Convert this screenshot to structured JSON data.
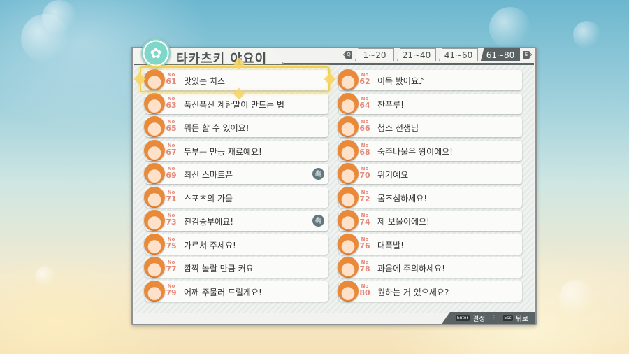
{
  "header": {
    "title": "타카츠키 야요이",
    "logo_icon": "idol-emblem-icon"
  },
  "tabs": [
    {
      "label": "1~20",
      "active": false
    },
    {
      "label": "21~40",
      "active": false
    },
    {
      "label": "41~60",
      "active": false
    },
    {
      "label": "61~80",
      "active": true
    }
  ],
  "tab_prev_key": "Q",
  "tab_next_key": "E",
  "no_prefix": "No",
  "items": [
    {
      "no": "61",
      "label": "맛있는 치즈",
      "clip": false
    },
    {
      "no": "62",
      "label": "이득 봤어요♪",
      "clip": false
    },
    {
      "no": "63",
      "label": "푹신푹신 계란말이 만드는 법",
      "clip": false
    },
    {
      "no": "64",
      "label": "찬푸루!",
      "clip": false
    },
    {
      "no": "65",
      "label": "뭐든 할 수 있어요!",
      "clip": false
    },
    {
      "no": "66",
      "label": "청소 선생님",
      "clip": false
    },
    {
      "no": "67",
      "label": "두부는 만능 재료예요!",
      "clip": false
    },
    {
      "no": "68",
      "label": "숙주나물은 왕이에요!",
      "clip": false
    },
    {
      "no": "69",
      "label": "최신 스마트폰",
      "clip": true
    },
    {
      "no": "70",
      "label": "위기예요",
      "clip": false
    },
    {
      "no": "71",
      "label": "스포츠의 가을",
      "clip": false
    },
    {
      "no": "72",
      "label": "몸조심하세요!",
      "clip": false
    },
    {
      "no": "73",
      "label": "진검승부예요!",
      "clip": true
    },
    {
      "no": "74",
      "label": "제 보물이에요!",
      "clip": false
    },
    {
      "no": "75",
      "label": "가르쳐 주세요!",
      "clip": false
    },
    {
      "no": "76",
      "label": "대폭발!",
      "clip": false
    },
    {
      "no": "77",
      "label": "깜짝 놀랄 만큼 커요",
      "clip": false
    },
    {
      "no": "78",
      "label": "과음에 주의하세요!",
      "clip": false
    },
    {
      "no": "79",
      "label": "어깨 주물러 드릴게요!",
      "clip": false
    },
    {
      "no": "80",
      "label": "원하는 거 있으세요?",
      "clip": false
    }
  ],
  "selected_no": "61",
  "footer": {
    "confirm_key": "Enter",
    "confirm_label": "결정",
    "back_key": "Esc",
    "back_label": "뒤로"
  },
  "colors": {
    "accent_cursor": "#f0cf5a",
    "number_badge": "#e48a7c",
    "bar_dark": "#5b6264"
  }
}
